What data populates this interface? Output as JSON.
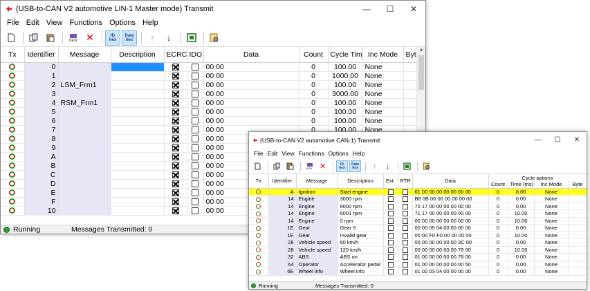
{
  "w1": {
    "title": "(USB-to-CAN V2 automotive  LIN-1 Master mode) Transmit",
    "menu": [
      "File",
      "Edit",
      "View",
      "Functions",
      "Options",
      "Help"
    ],
    "columns": [
      "Tx",
      "Identifier",
      "Message",
      "Description",
      "ECRC",
      "IDO",
      "Data",
      "Count",
      "Cycle Time",
      "Inc Mode",
      "Byte"
    ],
    "rows": [
      {
        "id": "0",
        "msg": "",
        "desc": "",
        "ecrc": true,
        "ido": false,
        "data": "00 00",
        "count": "0",
        "cycle": "100.00",
        "inc": "None",
        "byte": ""
      },
      {
        "id": "1",
        "msg": "",
        "desc": "",
        "ecrc": true,
        "ido": false,
        "data": "00 00",
        "count": "0",
        "cycle": "1000.00",
        "inc": "None",
        "byte": ""
      },
      {
        "id": "2",
        "msg": "LSM_Frm1",
        "desc": "",
        "ecrc": true,
        "ido": false,
        "data": "00 00",
        "count": "0",
        "cycle": "100.00",
        "inc": "None",
        "byte": ""
      },
      {
        "id": "3",
        "msg": "",
        "desc": "",
        "ecrc": true,
        "ido": false,
        "data": "00 00",
        "count": "0",
        "cycle": "3000.00",
        "inc": "None",
        "byte": ""
      },
      {
        "id": "4",
        "msg": "RSM_Frm1",
        "desc": "",
        "ecrc": true,
        "ido": false,
        "data": "00 00",
        "count": "0",
        "cycle": "100.00",
        "inc": "None",
        "byte": ""
      },
      {
        "id": "5",
        "msg": "",
        "desc": "",
        "ecrc": true,
        "ido": false,
        "data": "00 00",
        "count": "0",
        "cycle": "100.00",
        "inc": "None",
        "byte": ""
      },
      {
        "id": "6",
        "msg": "",
        "desc": "",
        "ecrc": true,
        "ido": false,
        "data": "00 00",
        "count": "0",
        "cycle": "100.00",
        "inc": "None",
        "byte": ""
      },
      {
        "id": "7",
        "msg": "",
        "desc": "",
        "ecrc": true,
        "ido": false,
        "data": "00 00",
        "count": "0",
        "cycle": "100.00",
        "inc": "None",
        "byte": ""
      },
      {
        "id": "8",
        "msg": "",
        "desc": "",
        "ecrc": true,
        "ido": false,
        "data": "00 00",
        "count": "",
        "cycle": "",
        "inc": "",
        "byte": ""
      },
      {
        "id": "9",
        "msg": "",
        "desc": "",
        "ecrc": true,
        "ido": false,
        "data": "00 00",
        "count": "",
        "cycle": "",
        "inc": "",
        "byte": ""
      },
      {
        "id": "A",
        "msg": "",
        "desc": "",
        "ecrc": true,
        "ido": false,
        "data": "00 00",
        "count": "",
        "cycle": "",
        "inc": "",
        "byte": ""
      },
      {
        "id": "B",
        "msg": "",
        "desc": "",
        "ecrc": true,
        "ido": false,
        "data": "00 00",
        "count": "",
        "cycle": "",
        "inc": "",
        "byte": ""
      },
      {
        "id": "C",
        "msg": "",
        "desc": "",
        "ecrc": true,
        "ido": false,
        "data": "00 00",
        "count": "",
        "cycle": "",
        "inc": "",
        "byte": ""
      },
      {
        "id": "D",
        "msg": "",
        "desc": "",
        "ecrc": true,
        "ido": false,
        "data": "00 00",
        "count": "",
        "cycle": "",
        "inc": "",
        "byte": ""
      },
      {
        "id": "E",
        "msg": "",
        "desc": "",
        "ecrc": true,
        "ido": false,
        "data": "00 00",
        "count": "",
        "cycle": "",
        "inc": "",
        "byte": ""
      },
      {
        "id": "F",
        "msg": "",
        "desc": "",
        "ecrc": true,
        "ido": false,
        "data": "00 00",
        "count": "",
        "cycle": "",
        "inc": "",
        "byte": ""
      },
      {
        "id": "10",
        "msg": "",
        "desc": "",
        "ecrc": true,
        "ido": false,
        "data": "00 00",
        "count": "",
        "cycle": "",
        "inc": "",
        "byte": ""
      }
    ],
    "status": "Running",
    "transmitted": "Messages Transmitted: 0"
  },
  "w2": {
    "title": "(USB-to-CAN V2 automotive  CAN-1) Transmit",
    "menu": [
      "File",
      "Edit",
      "View",
      "Functions",
      "Options",
      "Help"
    ],
    "columns": [
      "Tx",
      "Identifier",
      "Message",
      "Description",
      "Ext.",
      "RTR",
      "Data",
      "Count",
      "Time (ms)",
      "Inc Mode",
      "Byte"
    ],
    "cycle_header": "Cycle options",
    "rows": [
      {
        "id": "A",
        "msg": "Ignition",
        "desc": "Start engine",
        "ext": false,
        "rtr": false,
        "data": "01 00 00 00 00 00 00 00",
        "count": "0",
        "time": "0.00",
        "inc": "None",
        "byte": "",
        "selected": true
      },
      {
        "id": "14",
        "msg": "Engine",
        "desc": "3000 rpm",
        "ext": false,
        "rtr": false,
        "data": "B8 0B 00 00 00 00 00 00",
        "count": "0",
        "time": "0.00",
        "inc": "None",
        "byte": ""
      },
      {
        "id": "14",
        "msg": "Engine",
        "desc": "6000 rpm",
        "ext": false,
        "rtr": false,
        "data": "70 17 00 00 00 00 00 00",
        "count": "0",
        "time": "0.00",
        "inc": "None",
        "byte": ""
      },
      {
        "id": "14",
        "msg": "Engine",
        "desc": "6001 rpm",
        "ext": false,
        "rtr": false,
        "data": "71 17 00 00 00 00 00 00",
        "count": "0",
        "time": "10.00",
        "inc": "None",
        "byte": ""
      },
      {
        "id": "14",
        "msg": "Engine",
        "desc": "0 rpm",
        "ext": false,
        "rtr": false,
        "data": "00 00 00 00 00 00 00 00",
        "count": "0",
        "time": "10.00",
        "inc": "None",
        "byte": ""
      },
      {
        "id": "1E",
        "msg": "Gear",
        "desc": "Gear 5",
        "ext": false,
        "rtr": false,
        "data": "00 00 05 04 00 00 00 00",
        "count": "0",
        "time": "0.00",
        "inc": "None",
        "byte": ""
      },
      {
        "id": "1E",
        "msg": "Gear",
        "desc": "Invalid gear",
        "ext": false,
        "rtr": false,
        "data": "00 00 F0 F0 00 00 00 00",
        "count": "0",
        "time": "10.00",
        "inc": "None",
        "byte": ""
      },
      {
        "id": "28",
        "msg": "Vehicle speed",
        "desc": "60 km/h",
        "ext": false,
        "rtr": false,
        "data": "00 00 00 00 00 00 3C 00",
        "count": "0",
        "time": "0.00",
        "inc": "None",
        "byte": ""
      },
      {
        "id": "28",
        "msg": "Vehicle speed",
        "desc": "120 km/h",
        "ext": false,
        "rtr": false,
        "data": "00 00 00 00 00 00 78 00",
        "count": "0",
        "time": "10.00",
        "inc": "None",
        "byte": ""
      },
      {
        "id": "32",
        "msg": "ABS",
        "desc": "ABS on",
        "ext": false,
        "rtr": false,
        "data": "01 00 00 00 00 00 78 00",
        "count": "0",
        "time": "0.00",
        "inc": "None",
        "byte": ""
      },
      {
        "id": "64",
        "msg": "Operator",
        "desc": "Accelerator pedal",
        "ext": false,
        "rtr": false,
        "data": "01 00 00 00 00 00 00 50",
        "count": "0",
        "time": "0.00",
        "inc": "None",
        "byte": ""
      },
      {
        "id": "6E",
        "msg": "Wheel info",
        "desc": "Wheel info",
        "ext": false,
        "rtr": false,
        "data": "01 02 03 04 00 00 00 00",
        "count": "0",
        "time": "0.00",
        "inc": "None",
        "byte": ""
      }
    ],
    "status": "Running",
    "transmitted": "Messages Transmitted: 0"
  },
  "colors": {
    "selected_row": "#ffff1a",
    "message_column": "#e6e6f7",
    "selected_cell": "#1e90ff",
    "running": "#2ea02e"
  }
}
